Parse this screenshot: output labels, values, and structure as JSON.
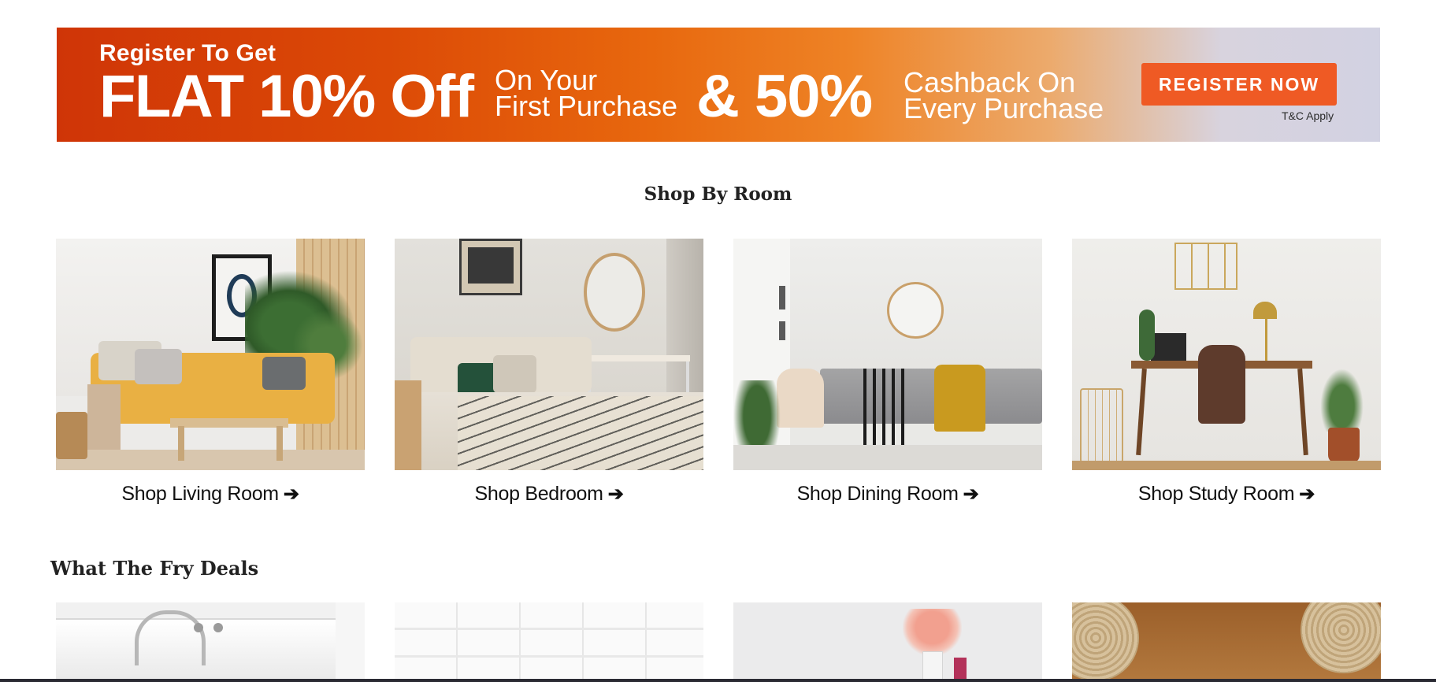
{
  "banner": {
    "register_to_get": "Register To Get",
    "flat_off": "FLAT 10% Off",
    "on_your_line1": "On Your",
    "on_your_line2": "First Purchase",
    "cashback_amount": "& 50%",
    "cashback_line1": "Cashback On",
    "cashback_line2": "Every Purchase",
    "register_button": "REGISTER NOW",
    "tc": "T&C Apply"
  },
  "shop_by_room": {
    "title": "Shop By Room",
    "rooms": [
      {
        "label": "Shop Living Room"
      },
      {
        "label": "Shop Bedroom"
      },
      {
        "label": "Shop Dining Room"
      },
      {
        "label": "Shop Study Room"
      }
    ]
  },
  "deals": {
    "title": "What The Fry Deals"
  },
  "icons": {
    "room_link_arrow": "arrow-right-icon"
  },
  "colors": {
    "banner_start": "#cf3507",
    "banner_end": "#d2d2e2",
    "register_button": "#ef5a24"
  }
}
